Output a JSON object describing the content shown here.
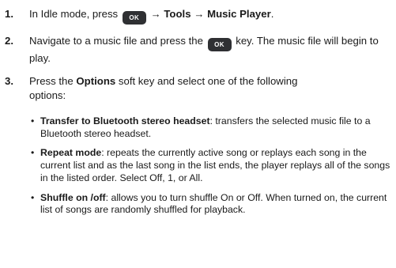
{
  "steps": [
    {
      "number": "1.",
      "pre": "In Idle mode, press",
      "key_label": "OK",
      "arrow1": "→",
      "menu1": "Tools",
      "arrow2": "→",
      "menu2": "Music Player",
      "end": "."
    },
    {
      "number": "2.",
      "pre": "Navigate to a music file and press the",
      "key_label": "OK",
      "post": "key. The music file will begin to play."
    },
    {
      "number": "3.",
      "pre": "Press the",
      "options_label": "Options",
      "post": "soft key and select one of the following options:"
    }
  ],
  "bullets": [
    {
      "term": "Transfer to Bluetooth stereo headset",
      "desc": ": transfers the selected music file to a Bluetooth stereo headset."
    },
    {
      "term": "Repeat mode",
      "desc": ": repeats the currently active song or replays each song in the current list and as the last song in the list ends, the player replays all of the songs in the listed order. Select Off, 1, or All."
    },
    {
      "term": "Shuffle on /off",
      "desc": ": allows you to turn shuffle On or Off. When turned on, the current list of songs are randomly shuffled for playback."
    }
  ],
  "bullet_char": "•"
}
